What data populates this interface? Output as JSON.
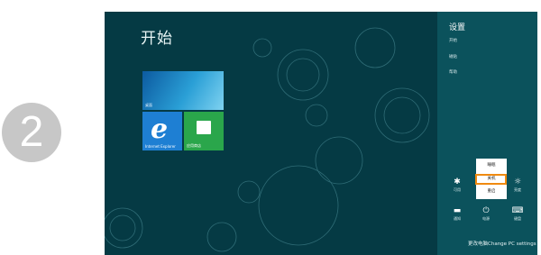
{
  "step_number": "2",
  "start_screen": {
    "title": "开始",
    "tiles": {
      "desktop_label": "桌面",
      "ie_label": "Internet Explorer",
      "ie_glyph": "e",
      "store_label": "应用商店"
    }
  },
  "settings_charm": {
    "title": "设置",
    "links": [
      "开始",
      "磁贴",
      "帮助"
    ],
    "quick_settings": [
      {
        "label": "可用",
        "icon": "network-icon"
      },
      {
        "label": "音量",
        "icon": "volume-icon"
      },
      {
        "label": "亮度",
        "icon": "brightness-icon"
      },
      {
        "label": "通知",
        "icon": "notifications-icon"
      },
      {
        "label": "电源",
        "icon": "power-icon"
      },
      {
        "label": "键盘",
        "icon": "keyboard-icon"
      }
    ],
    "change_pc_settings": "更改电脑Change PC settings"
  },
  "power_menu": {
    "items": [
      "睡眠",
      "关机",
      "重启"
    ],
    "highlighted": "关机",
    "highlight_color": "#f08a10"
  },
  "colors": {
    "screen_background": "#053a44",
    "charm_background": "#0b525c",
    "step_circle": "#c7c7c7"
  }
}
